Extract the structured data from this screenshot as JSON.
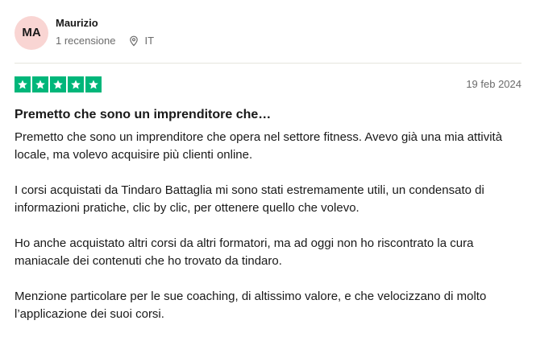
{
  "reviewer": {
    "initials": "MA",
    "name": "Maurizio",
    "review_count": "1 recensione",
    "country": "IT"
  },
  "rating": {
    "stars": 5,
    "max": 5,
    "color": "#00b67a"
  },
  "review": {
    "date": "19 feb 2024",
    "title": "Premetto che sono un imprenditore che…",
    "paragraphs": [
      "Premetto che sono un imprenditore che opera nel settore fitness. Avevo già una mia attività locale, ma volevo acquisire più clienti online.",
      "I corsi acquistati da Tindaro Battaglia mi sono stati estremamente utili, un condensato di informazioni pratiche, clic by clic, per ottenere quello che volevo.",
      "Ho anche acquistato altri corsi da altri formatori, ma ad oggi non ho riscontrato la cura maniacale dei contenuti che ho trovato da tindaro.",
      "Menzione particolare per le sue coaching, di altissimo valore, e che velocizzano di molto l’applicazione dei suoi corsi."
    ]
  },
  "icons": {
    "location": "location-pin-icon",
    "star": "star-icon"
  }
}
